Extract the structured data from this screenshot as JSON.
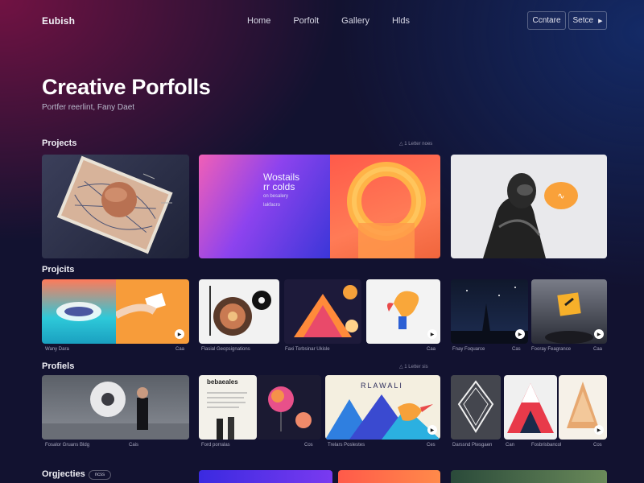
{
  "nav": {
    "logo": "Eubish",
    "links": [
      "Home",
      "Porfolt",
      "Gallery",
      "Hlds"
    ],
    "buttons": [
      {
        "label": "Ccntare",
        "icon": ""
      },
      {
        "label": "Setce",
        "icon": "chevron-right-icon"
      }
    ]
  },
  "hero": {
    "title": "Creative Porfolls",
    "subtitle": "Portfer reerlint, Fany Daet"
  },
  "sections": [
    {
      "title": "Projects",
      "meta": "△  1 Letter noes"
    },
    {
      "title": "Projcits"
    },
    {
      "title": "Profiels",
      "meta": "△  1 Letter sis"
    },
    {
      "title": "Orgjecties",
      "chip": "ncss"
    }
  ],
  "featured": {
    "card2_text": "Wostails",
    "card2_line2": "rr colds",
    "card2_sub1": "on besalery",
    "card2_sub2": "lakfacro"
  },
  "row2_captions": [
    {
      "left": "Wany Dara",
      "right": "Caa"
    },
    {
      "left": "Flasial Geopsignations",
      "right": "Coa"
    },
    {
      "left": "Faxi Torbsinar Ukisle",
      "right": "Caa"
    },
    {
      "left": "Fnay Foquarce",
      "right": "Cas"
    },
    {
      "left": "Fooray Feagrance",
      "right": "Caa"
    }
  ],
  "row3_captions": [
    {
      "left": "Fosalor Gruans Bldg",
      "right": "Cais"
    },
    {
      "left": "Ford porralas",
      "right": "Cos"
    },
    {
      "left": "Trelars Poslestes",
      "right": "Ces"
    },
    {
      "left": "Darssnd Ptesgaen",
      "right": "Can"
    },
    {
      "left": "Fosbrisbancol",
      "right": "Cos"
    }
  ],
  "row3_art": {
    "doc_title": "bebaeales",
    "poster_title": "RLAWALI"
  },
  "colors": {
    "background": "#121230",
    "accent_orange": "#f79c3a",
    "accent_purple": "#8a3df0"
  }
}
